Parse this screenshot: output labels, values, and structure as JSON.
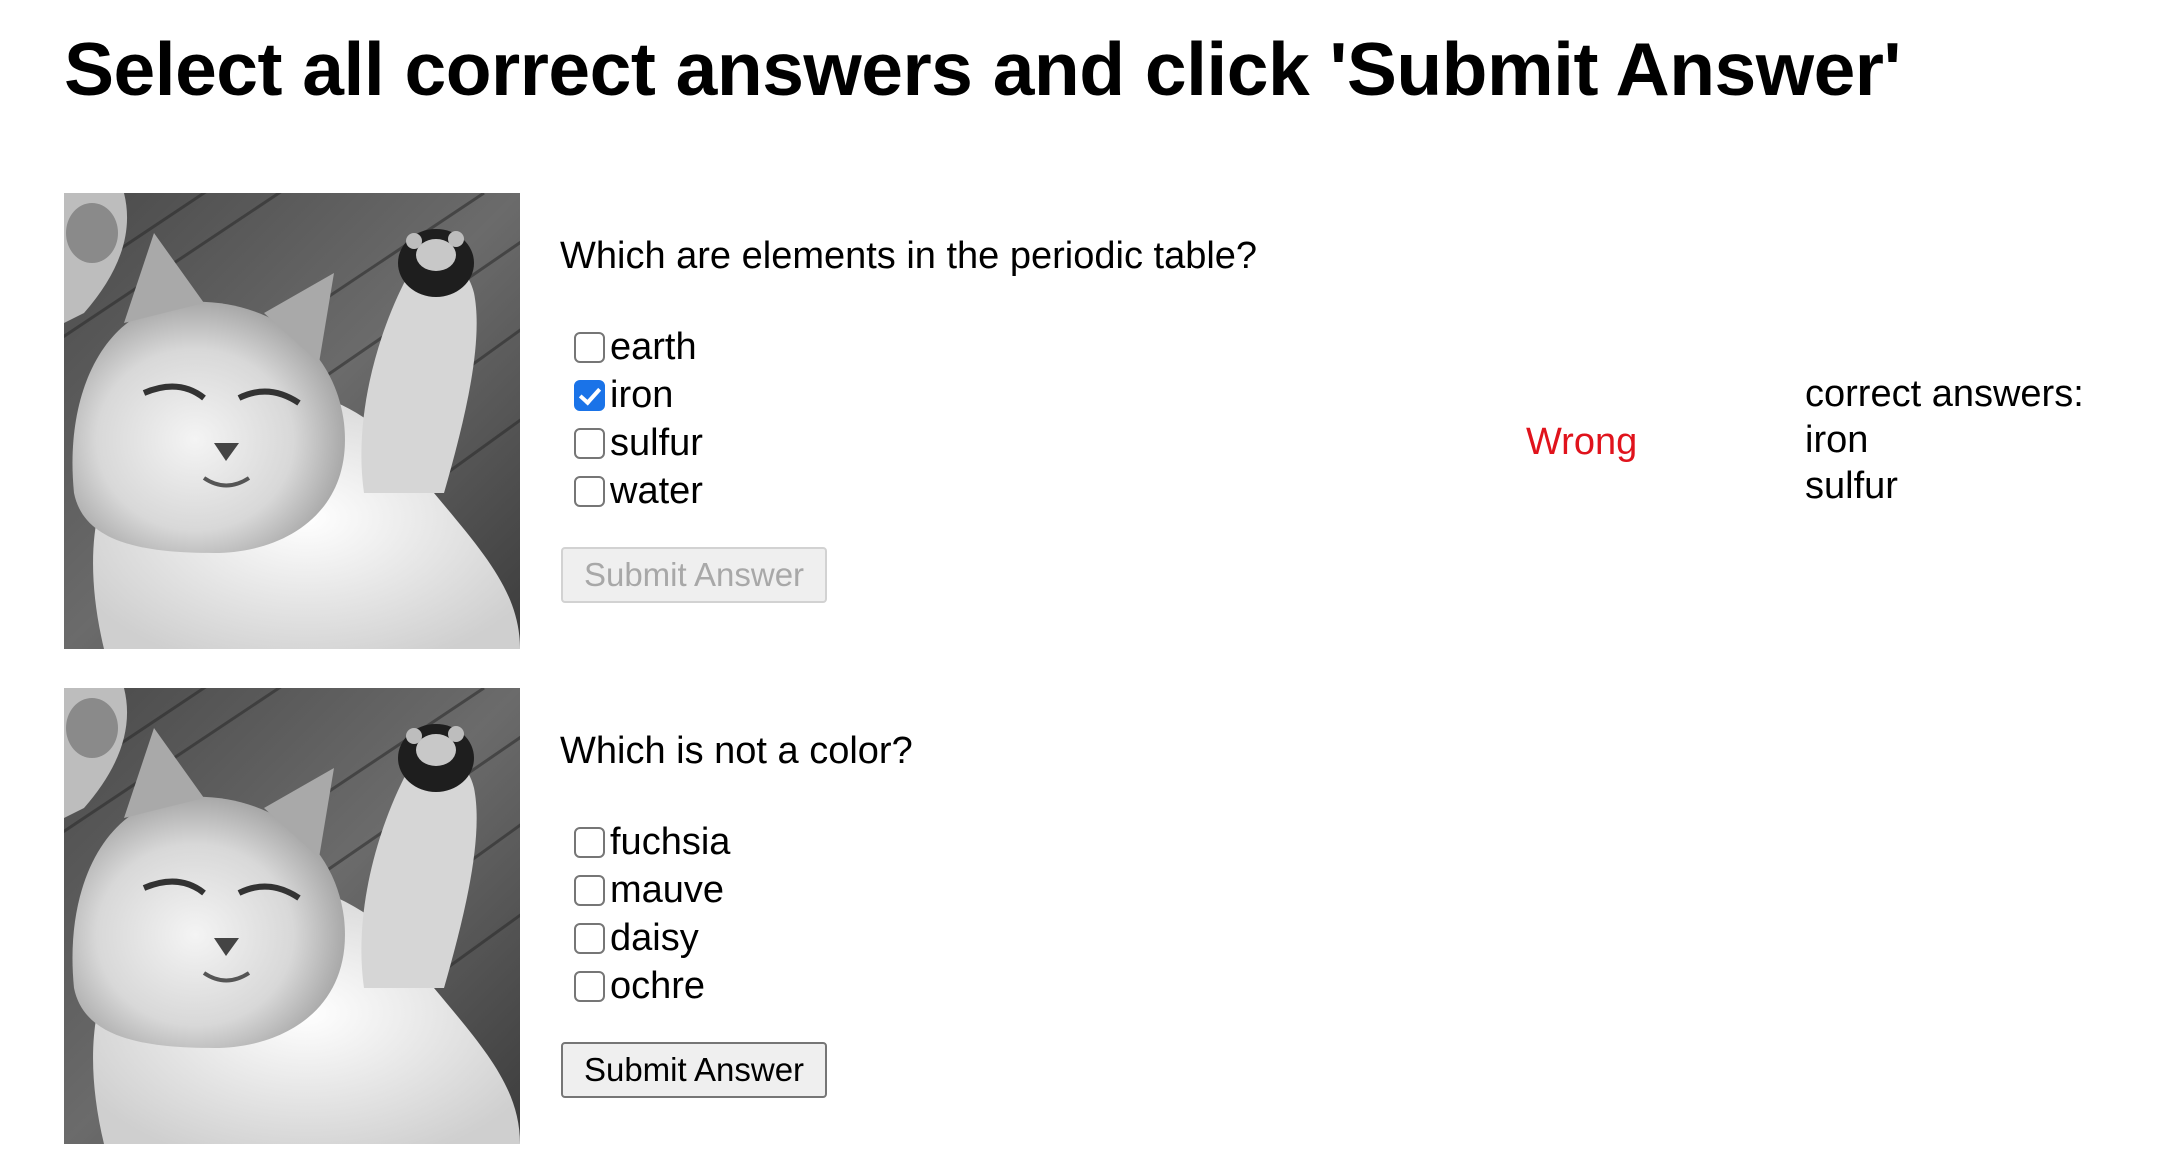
{
  "header": {
    "title": "Select all correct answers and click 'Submit Answer'"
  },
  "colors": {
    "checkbox_checked": "#1a73e8",
    "wrong_text": "#e0131c",
    "disabled_text": "#a8a8a8"
  },
  "quizzes": [
    {
      "image_icon": "kitten-photo",
      "question": "Which are elements in the periodic table?",
      "options": [
        {
          "label": "earth",
          "checked": false
        },
        {
          "label": "iron",
          "checked": true
        },
        {
          "label": "sulfur",
          "checked": false
        },
        {
          "label": "water",
          "checked": false
        }
      ],
      "submit_label": "Submit Answer",
      "submit_disabled": true,
      "result": "Wrong",
      "correct_heading": "correct answers:",
      "correct_answers": [
        "iron",
        "sulfur"
      ]
    },
    {
      "image_icon": "kitten-photo",
      "question": "Which is not a color?",
      "options": [
        {
          "label": "fuchsia",
          "checked": false
        },
        {
          "label": "mauve",
          "checked": false
        },
        {
          "label": "daisy",
          "checked": false
        },
        {
          "label": "ochre",
          "checked": false
        }
      ],
      "submit_label": "Submit Answer",
      "submit_disabled": false
    }
  ]
}
